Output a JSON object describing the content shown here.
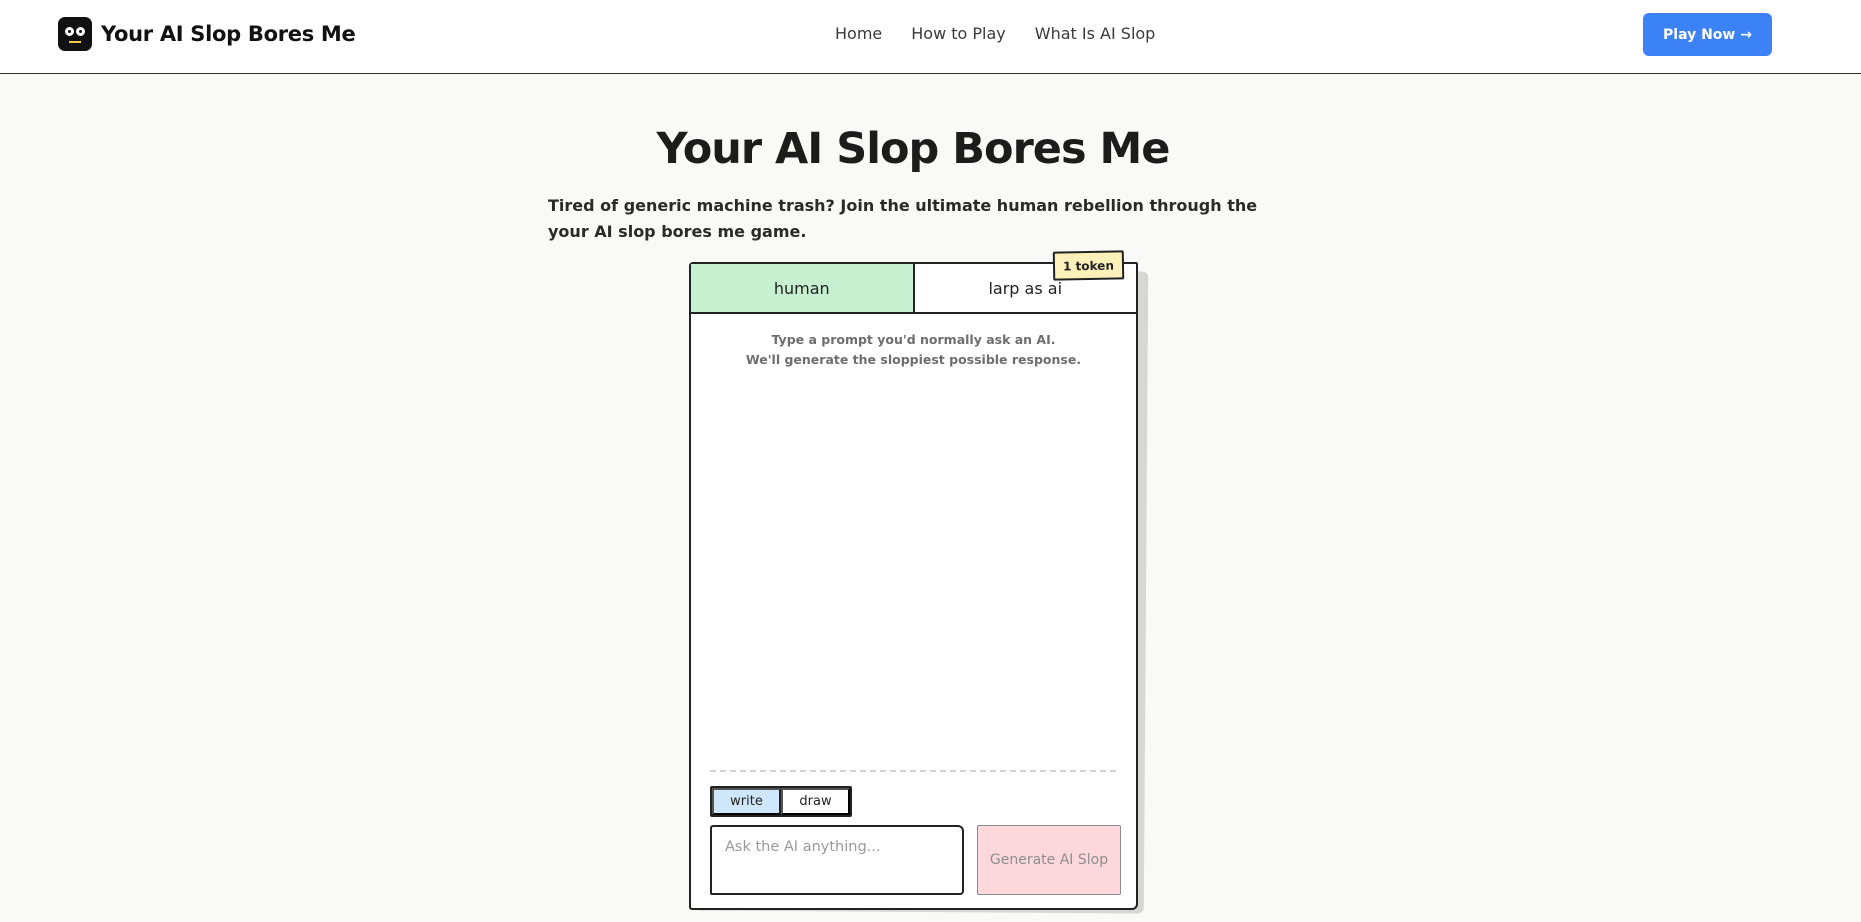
{
  "header": {
    "brand_name": "Your AI Slop Bores Me",
    "nav": [
      {
        "label": "Home"
      },
      {
        "label": "How to Play"
      },
      {
        "label": "What Is AI Slop"
      }
    ],
    "cta_label": "Play Now →",
    "cta_color": "#3b82f6"
  },
  "hero": {
    "title": "Your AI Slop Bores Me",
    "subtitle": "Tired of generic machine trash? Join the ultimate human rebellion through the your AI slop bores me game."
  },
  "game": {
    "tabs": [
      {
        "label": "human",
        "active": true
      },
      {
        "label": "larp as ai",
        "active": false
      }
    ],
    "token_badge": "1 token",
    "hint_line1": "Type a prompt you'd normally ask an AI.",
    "hint_line2": "We'll generate the sloppiest possible response.",
    "modes": [
      {
        "label": "write",
        "active": true
      },
      {
        "label": "draw",
        "active": false
      }
    ],
    "input": {
      "placeholder": "Ask the AI anything...",
      "value": ""
    },
    "generate_label": "Generate AI Slop",
    "colors": {
      "human_tab": "#c6f0d0",
      "token_badge": "#fdf0b8",
      "write_mode": "#cfe6fb",
      "generate_button": "#fcd7dc"
    }
  }
}
